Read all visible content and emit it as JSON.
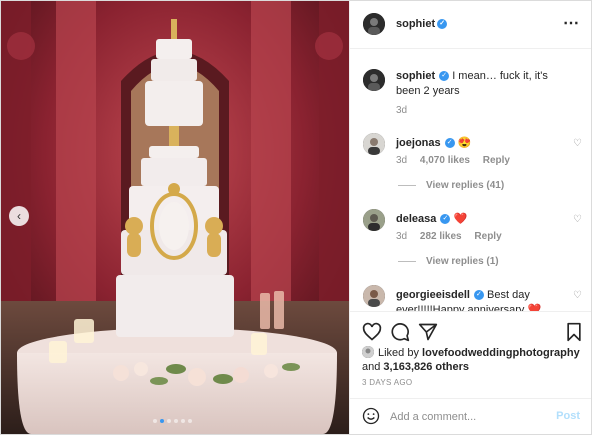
{
  "header": {
    "username": "sophiet",
    "verified_icon": "verified-badge-icon",
    "more_icon": "more-options-icon"
  },
  "caption": {
    "username": "sophiet",
    "text": "I mean… fuck it, it's been 2 years",
    "time": "3d"
  },
  "comments": [
    {
      "username": "joejonas",
      "text": "",
      "emoji": "😍",
      "time": "3d",
      "likes": "4,070 likes",
      "reply": "Reply",
      "view_replies": "View replies (41)"
    },
    {
      "username": "deleasa",
      "text": "",
      "emoji": "❤️",
      "time": "3d",
      "likes": "282 likes",
      "reply": "Reply",
      "view_replies": "View replies (1)"
    },
    {
      "username": "georgieeisdell",
      "text": "Best day ever!!!!!Happy anniversary",
      "emoji": "❤️"
    }
  ],
  "likes": {
    "prefix": "Liked by",
    "first_user": "lovefoodweddingphotography",
    "and": "and",
    "count": "3,163,826 others"
  },
  "timestamp": "3 DAYS AGO",
  "compose": {
    "placeholder": "Add a comment...",
    "post_label": "Post"
  },
  "colors": {
    "accent": "#3897f0",
    "post_disabled": "#b2dffc",
    "like_heart": "#ed4956"
  },
  "carousel": {
    "slides": 6,
    "active": 1
  }
}
